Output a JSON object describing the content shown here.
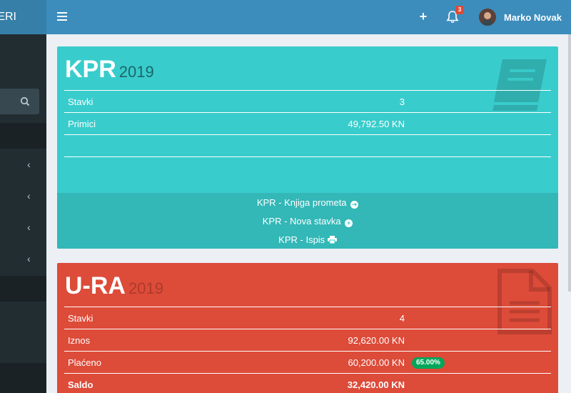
{
  "app": {
    "logo_text": "ERI"
  },
  "header": {
    "notifications_count": "3",
    "user_name": "Marko Novak"
  },
  "kpr": {
    "title": "KPR",
    "year": "2019",
    "rows": [
      {
        "label": "Stavki",
        "value": "3"
      },
      {
        "label": "Primici",
        "value": "49,792.50 KN"
      }
    ],
    "links": [
      {
        "label": "KPR - Knjiga prometa"
      },
      {
        "label": "KPR - Nova stavka"
      },
      {
        "label": "KPR - Ispis"
      }
    ]
  },
  "ura": {
    "title": "U-RA",
    "year": "2019",
    "rows": [
      {
        "label": "Stavki",
        "value": "4"
      },
      {
        "label": "Iznos",
        "value": "92,620.00 KN"
      },
      {
        "label": "Plaćeno",
        "value": "60,200.00 KN",
        "badge": "65.00%"
      },
      {
        "label": "Saldo",
        "value": "32,420.00 KN"
      }
    ]
  },
  "colors": {
    "kpr_box": "#39cccc",
    "ura_box": "#dd4b39",
    "header": "#3c8dbc",
    "sidebar": "#222d32",
    "badge_success": "#00a65a"
  }
}
